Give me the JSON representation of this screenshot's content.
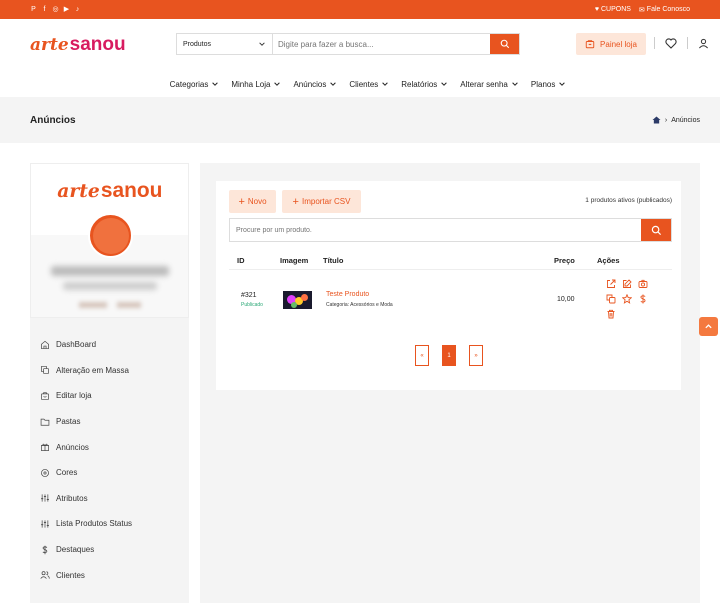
{
  "topbar": {
    "socials": [
      "pinterest-icon",
      "facebook-icon",
      "instagram-icon",
      "youtube-icon",
      "tiktok-icon"
    ],
    "cupons": "CUPONS",
    "contact": "Fale Conosco"
  },
  "header": {
    "logo_part1": "arte",
    "logo_part2": "sanou",
    "search_category": "Produtos",
    "search_placeholder": "Digite para fazer a busca...",
    "painel_label": "Painel loja"
  },
  "nav": [
    "Categorias",
    "Minha Loja",
    "Anúncios",
    "Clientes",
    "Relatórios",
    "Alterar senha",
    "Planos"
  ],
  "page": {
    "title": "Anúncios",
    "breadcrumb": "Anúncios"
  },
  "sidebar": {
    "logo_part1": "arte",
    "logo_part2": "sanou",
    "items": [
      {
        "label": "DashBoard",
        "icon": "home-icon"
      },
      {
        "label": "Alteração em Massa",
        "icon": "copy-icon"
      },
      {
        "label": "Editar loja",
        "icon": "store-icon"
      },
      {
        "label": "Pastas",
        "icon": "folder-icon"
      },
      {
        "label": "Anúncios",
        "icon": "gift-icon"
      },
      {
        "label": "Cores",
        "icon": "palette-icon"
      },
      {
        "label": "Atributos",
        "icon": "sliders-icon"
      },
      {
        "label": "Lista Produtos Status",
        "icon": "sliders-icon"
      },
      {
        "label": "Destaques",
        "icon": "dollar-icon"
      },
      {
        "label": "Clientes",
        "icon": "users-icon"
      }
    ]
  },
  "products": {
    "new_label": "Novo",
    "import_label": "Importar CSV",
    "count_text": "1 produtos ativos (publicados)",
    "search_placeholder": "Procure por um produto.",
    "columns": {
      "id": "ID",
      "image": "Imagem",
      "title": "Título",
      "price": "Preço",
      "actions": "Ações"
    },
    "rows": [
      {
        "id": "#321",
        "status": "Publicado",
        "title": "Teste Produto",
        "category": "Categoria: Acessórios e Moda",
        "price": "10,00"
      }
    ],
    "pagination": {
      "prev": "«",
      "current": "1",
      "next": "»"
    }
  },
  "colors": {
    "accent": "#e8541f",
    "accent_light": "#fde6d9",
    "brand_pink": "#d81b60",
    "published": "#2aa876"
  }
}
